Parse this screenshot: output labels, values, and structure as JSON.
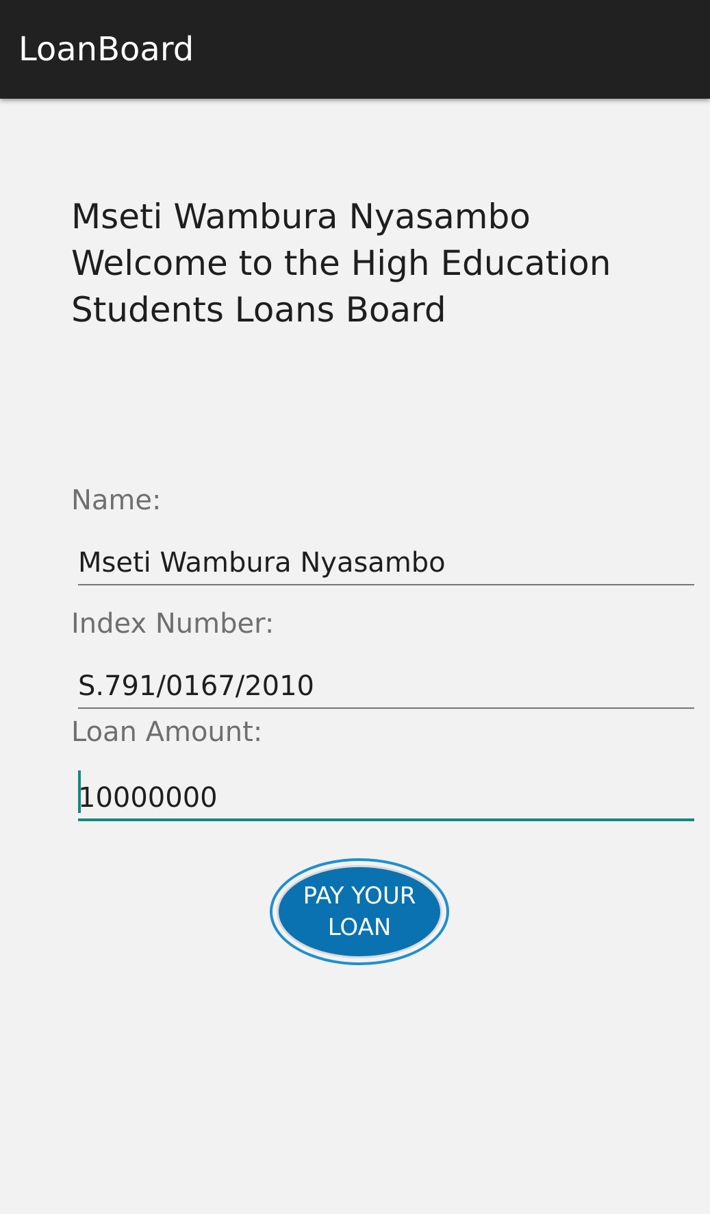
{
  "app_bar": {
    "title": "LoanBoard",
    "background_color": "#212121"
  },
  "welcome_message": "Mseti Wambura Nyasambo Welcome to the High Education Students Loans Board",
  "form": {
    "name": {
      "label": "Name:",
      "value": "Mseti Wambura Nyasambo"
    },
    "index_number": {
      "label": "Index Number:",
      "value": "S.791/0167/2010"
    },
    "loan_amount": {
      "label": "Loan Amount:",
      "value": "10000000",
      "focused": true
    }
  },
  "pay_button": {
    "label": "PAY YOUR LOAN",
    "color": "#0a72b0"
  },
  "colors": {
    "background": "#f2f2f2",
    "accent": "#11897f",
    "label": "#6f6f6f",
    "text": "#1e1e1e"
  }
}
